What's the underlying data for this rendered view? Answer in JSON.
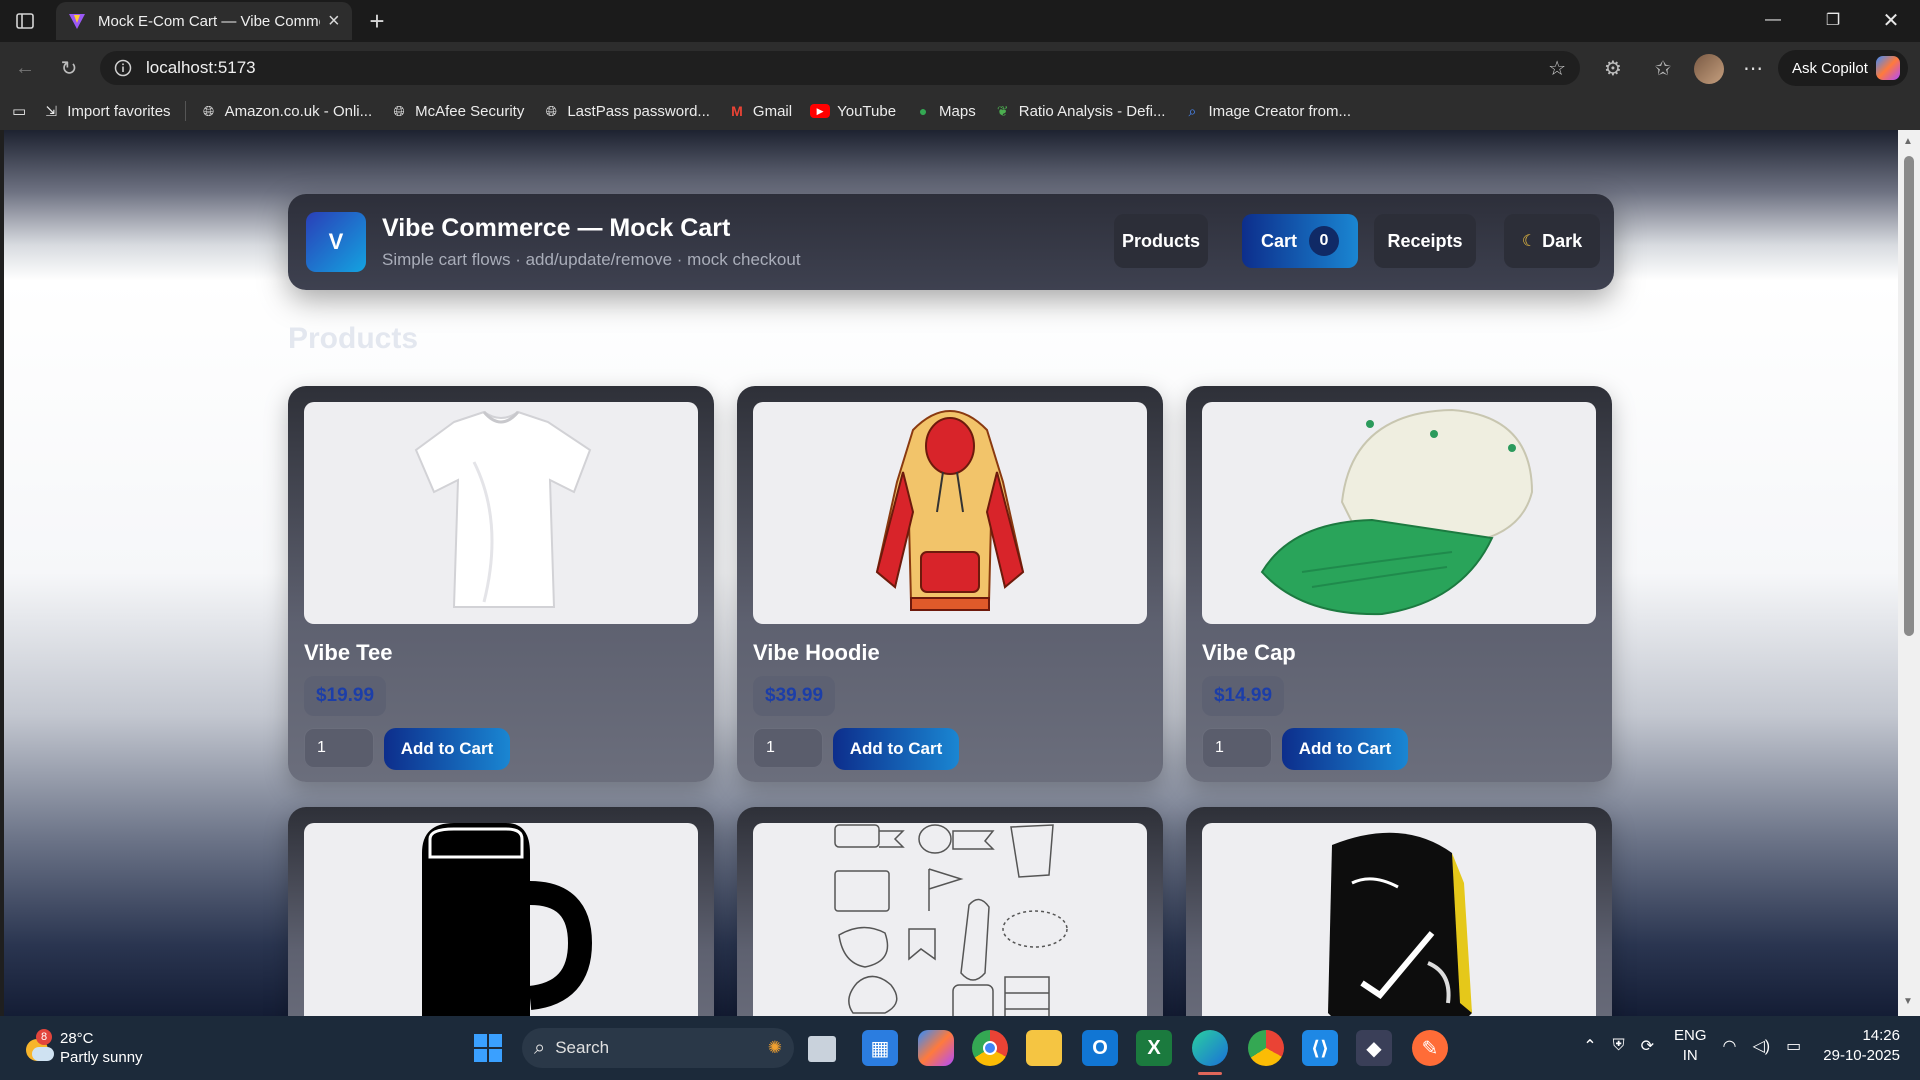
{
  "browser": {
    "tab_title": "Mock E-Com Cart — Vibe Comme",
    "url": "localhost:5173",
    "copilot_label": "Ask Copilot",
    "bookmarks": [
      {
        "label": "Import favorites",
        "icon": "import-icon"
      },
      {
        "label": "Amazon.co.uk - Onli...",
        "icon": "globe-icon"
      },
      {
        "label": "McAfee Security",
        "icon": "globe-icon"
      },
      {
        "label": "LastPass password...",
        "icon": "globe-icon"
      },
      {
        "label": "Gmail",
        "icon": "gmail-icon"
      },
      {
        "label": "YouTube",
        "icon": "youtube-icon"
      },
      {
        "label": "Maps",
        "icon": "maps-pin-icon"
      },
      {
        "label": "Ratio Analysis - Defi...",
        "icon": "leaf-icon"
      },
      {
        "label": "Image Creator from...",
        "icon": "search-icon"
      }
    ]
  },
  "app": {
    "logo_letter": "V",
    "title": "Vibe Commerce — Mock Cart",
    "subtitle": "Simple cart flows · add/update/remove · mock checkout",
    "nav": {
      "products": "Products",
      "cart": "Cart",
      "cart_count": "0",
      "receipts": "Receipts",
      "theme": "Dark"
    },
    "section_title": "Products",
    "add_label": "Add to Cart",
    "products": [
      {
        "name": "Vibe Tee",
        "price": "$19.99",
        "qty": "1",
        "image": "tshirt-image"
      },
      {
        "name": "Vibe Hoodie",
        "price": "$39.99",
        "qty": "1",
        "image": "hoodie-image"
      },
      {
        "name": "Vibe Cap",
        "price": "$14.99",
        "qty": "1",
        "image": "cap-image"
      },
      {
        "image": "mug-image"
      },
      {
        "image": "stickers-image"
      },
      {
        "image": "backpack-image"
      }
    ]
  },
  "taskbar": {
    "weather_temp": "28°C",
    "weather_desc": "Partly sunny",
    "weather_badge": "8",
    "search_label": "Search",
    "lang": "ENG",
    "region": "IN",
    "time": "14:26",
    "date": "29-10-2025"
  },
  "colors": {
    "accent_start": "#0d2e8c",
    "accent_end": "#1a86d2",
    "price_text": "#1c3ea8"
  }
}
